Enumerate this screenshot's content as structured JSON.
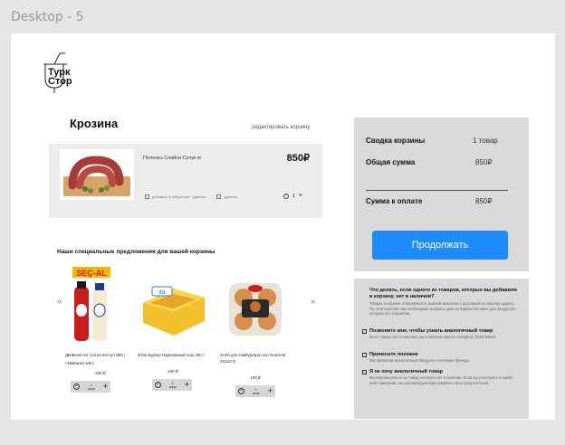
{
  "frame": {
    "label": "Desktop - 5"
  },
  "logo": {
    "line1": "Турк",
    "line2": "Стор"
  },
  "cart": {
    "title": "Крозина",
    "edit_link": "редактировать корзину",
    "item": {
      "name": "Полонез Спайси Сучук кг",
      "price": "850₽",
      "favorite_label": "добавить в избранное / удалить",
      "delete_label": "удалить",
      "quantity": "1"
    }
  },
  "offers": {
    "title": "Наши специальные предложения для вашей корзины",
    "prev_arrow": "«",
    "next_arrow": "»",
    "badge": "SEÇ-AL",
    "products": [
      {
        "name": "Двойной сет Сетья Кетчуп 890 г",
        "name2": "Майонез 540 г",
        "price": "340 ₽",
        "qty": "1",
        "unit": "штук"
      },
      {
        "name": "Итан Бургер Нарезанный сыр 200 г",
        "name2": "",
        "price": "240 ₽",
        "qty": "1",
        "unit": "штук"
      },
      {
        "name": "Хлеб для гамбургера Uno Gourmet 4X110 G",
        "name2": "",
        "price": "190 ₽",
        "qty": "1",
        "unit": "штук"
      }
    ]
  },
  "summary": {
    "basket_label": "Сводка корзины",
    "basket_value": "1 товар",
    "total_label": "Общая сумма",
    "total_value": "850₽",
    "pay_label": "Сумма к оплате",
    "pay_value": "850₽",
    "continue_label": "Продолжать"
  },
  "info": {
    "question": "Что делать, если одного из товаров, которые вы добавили в корзину, нет в наличии?",
    "description": "Товары в корзине отправляются заказом магазина с доставкой по вашему адресу. По этой причине нам необходимо выбрать один из вариантов ниже для продуктов, которых нет в наличии.",
    "options": [
      {
        "title": "Позвоните мне, чтобы узнать аналогичный товар",
        "desc": "Если товара нет в наличии, мы позвоним вам по телефону 7843794933."
      },
      {
        "title": "Принесите похожие",
        "desc": "Мы приносим аналогичные продукты и похожие бренды."
      },
      {
        "title": "Я не хочу аналогичный товар",
        "desc": "Мы вернем деньги за товар, которого нет в наличии. Если вы участвуете в какой-либо кампании, мы рекомендуем вам изменить свои предпочтения."
      }
    ]
  },
  "colors": {
    "accent": "#1d8cf8",
    "panel": "#d9d9d9",
    "card": "#ececec"
  }
}
